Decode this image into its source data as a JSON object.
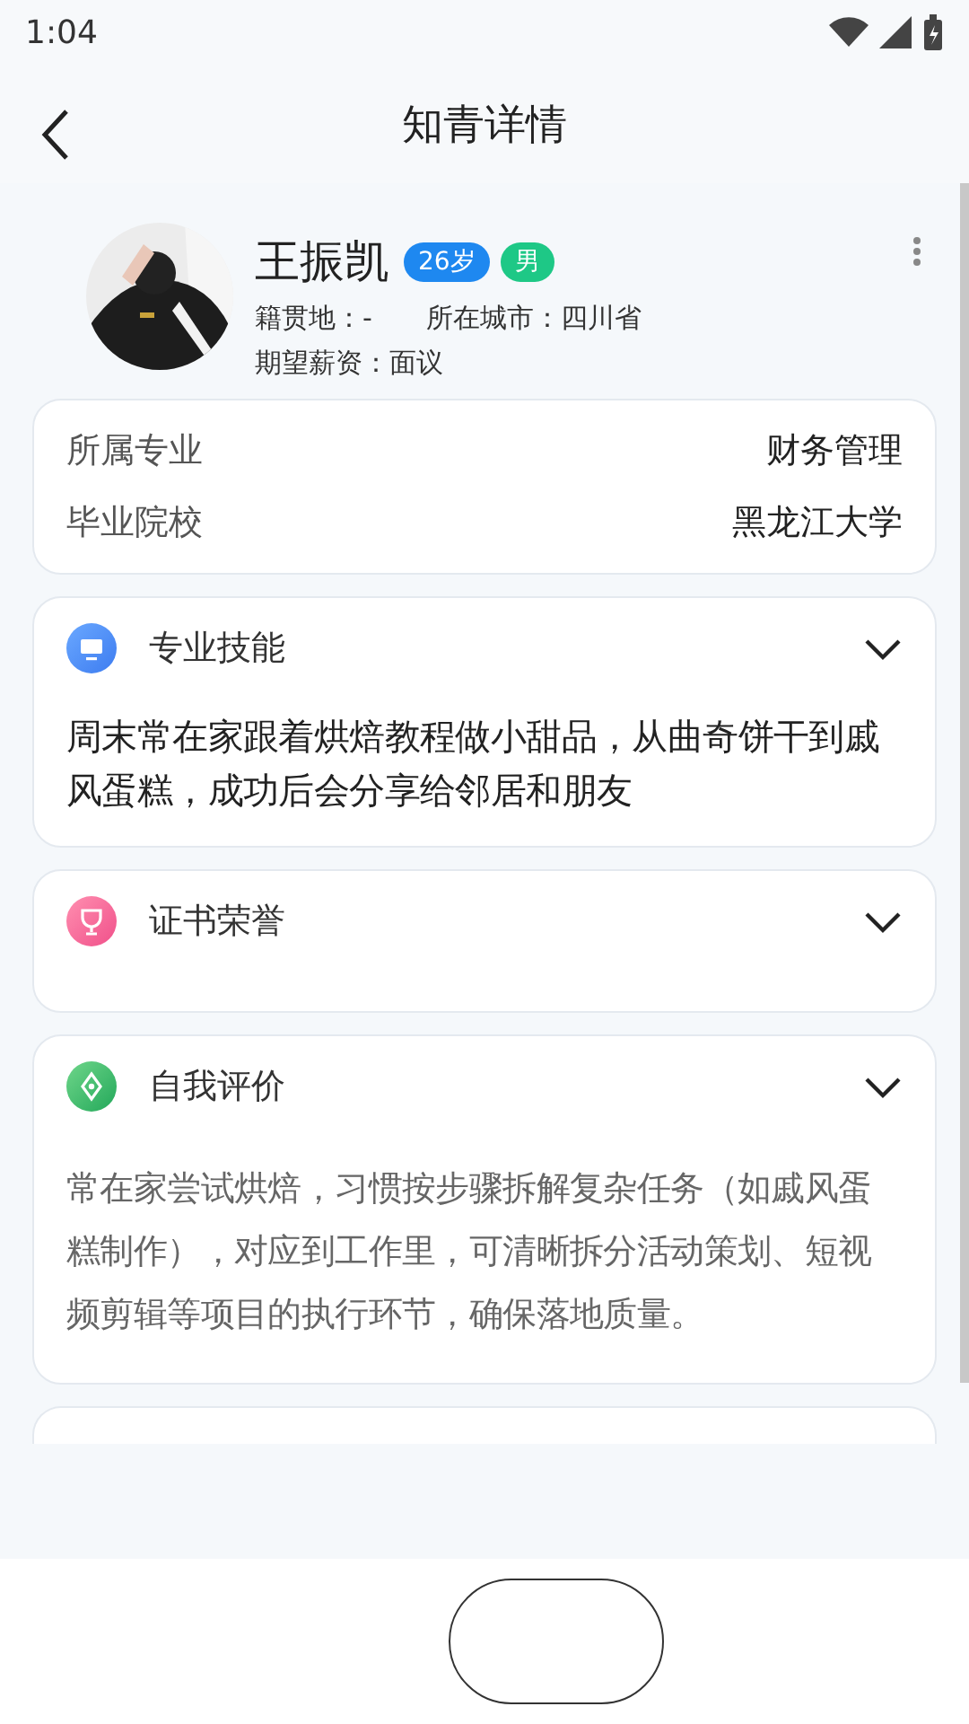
{
  "status_bar": {
    "time": "1:04"
  },
  "header": {
    "title": "知青详情"
  },
  "profile": {
    "name": "王振凯",
    "age": "26岁",
    "gender": "男",
    "hometown": "籍贯地：-",
    "city": "所在城市：四川省",
    "salary": "期望薪资：面议"
  },
  "info_card": {
    "rows": [
      {
        "label": "所属专业",
        "value": "财务管理"
      },
      {
        "label": "毕业院校",
        "value": "黑龙江大学"
      }
    ]
  },
  "sections": [
    {
      "kind": "skill",
      "title": "专业技能",
      "expanded": true,
      "body": "周末常在家跟着烘焙教程做小甜品，从曲奇饼干到戚风蛋糕，成功后会分享给邻居和朋友"
    },
    {
      "kind": "award",
      "title": "证书荣誉",
      "expanded": true
    },
    {
      "kind": "review",
      "title": "自我评价",
      "expanded": true,
      "body": "常在家尝试烘焙，习惯按步骤拆解复杂任务（如戚风蛋糕制作），对应到工作里，可清晰拆分活动策划、短视频剪辑等项目的执行环节，确保落地质量。"
    }
  ]
}
